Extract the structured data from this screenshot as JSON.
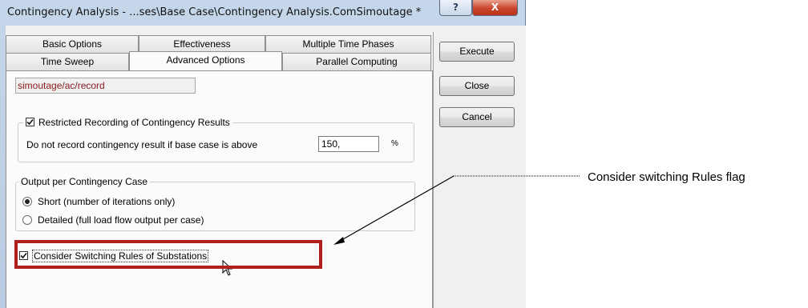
{
  "window": {
    "title": "Contingency Analysis - ...ses\\Base Case\\Contingency Analysis.ComSimoutage *",
    "help_glyph": "?",
    "close_glyph": "X"
  },
  "tabs": [
    {
      "label": "Basic Options"
    },
    {
      "label": "Effectiveness"
    },
    {
      "label": "Multiple Time Phases"
    },
    {
      "label": "Time Sweep"
    },
    {
      "label": "Advanced Options"
    },
    {
      "label": "Parallel Computing"
    }
  ],
  "active_tab": "Advanced Options",
  "buttons": {
    "execute": "Execute",
    "close": "Close",
    "cancel": "Cancel"
  },
  "path_field": "simoutage/ac/record",
  "restricted": {
    "label": "Restricted Recording of Contingency Results",
    "checked": true,
    "threshold_label": "Do not record contingency result if base case is above",
    "threshold_value": "150,",
    "unit": "%"
  },
  "output": {
    "legend": "Output per Contingency Case",
    "options": [
      {
        "label": "Short (number of iterations only)",
        "selected": true
      },
      {
        "label": "Detailed (full load flow output per case)",
        "selected": false
      }
    ]
  },
  "switching_rules": {
    "label": "Consider Switching Rules of Substations",
    "checked": true
  },
  "annotation": "Consider switching Rules flag",
  "colors": {
    "highlight_border": "#b01e1e",
    "path_text": "#8b1a1a"
  }
}
